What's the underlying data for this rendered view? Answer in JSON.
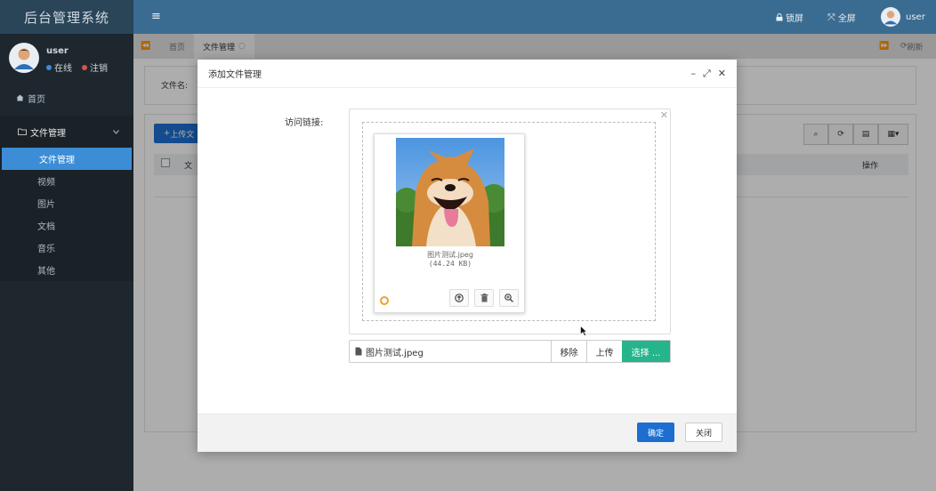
{
  "app": {
    "title": "后台管理系统"
  },
  "sidebar": {
    "user": {
      "name": "user",
      "status_online": "在线",
      "logout": "注销"
    },
    "home": "首页",
    "group": {
      "label": "文件管理",
      "items": [
        "文件管理",
        "视频",
        "图片",
        "文档",
        "音乐",
        "其他"
      ],
      "active_index": 0
    }
  },
  "header": {
    "lock": "锁屏",
    "fullscreen": "全屏",
    "user": "user"
  },
  "tabs": {
    "items": [
      "首页",
      "文件管理"
    ],
    "refresh": "刷新"
  },
  "background": {
    "search_label": "文件名:",
    "upload_button": "上传文",
    "table_header_prefix": "文",
    "table_header_actions": "操作"
  },
  "modal": {
    "title": "添加文件管理",
    "field_label": "访问链接:",
    "file": {
      "name": "图片测试.jpeg",
      "size": "(44.24 KB)"
    },
    "caption": "图片测试.jpeg",
    "buttons": {
      "remove": "移除",
      "upload": "上传",
      "select": "选择 ..."
    },
    "footer": {
      "confirm": "确定",
      "close": "关闭"
    }
  },
  "colors": {
    "header_bg": "#3a6c91",
    "sidebar_bg": "#1e272e",
    "active_item": "#3c8dd6",
    "primary_button": "#1c6fd1",
    "select_button": "#26b48c",
    "online_dot": "#3c8dd6",
    "logout_dot": "#d9534f"
  }
}
